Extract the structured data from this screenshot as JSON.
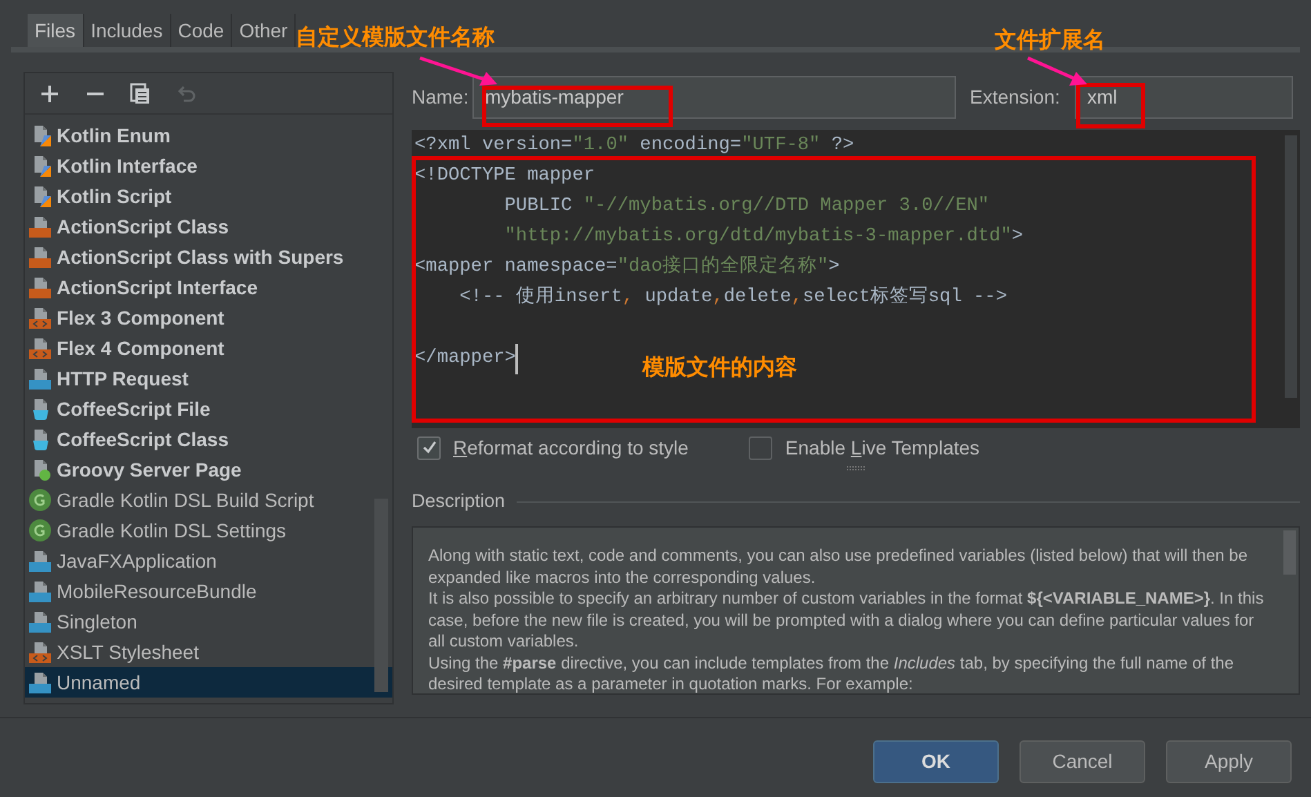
{
  "tabs": [
    {
      "label": "Files",
      "selected": true
    },
    {
      "label": "Includes",
      "selected": false
    },
    {
      "label": "Code",
      "selected": false
    },
    {
      "label": "Other",
      "selected": false
    }
  ],
  "toolbar": [
    {
      "kind": "add",
      "disabled": false
    },
    {
      "kind": "remove",
      "disabled": false
    },
    {
      "kind": "copy",
      "disabled": false
    },
    {
      "kind": "undo",
      "disabled": true
    }
  ],
  "templates": [
    {
      "label": "Kotlin Enum",
      "kind": "kotlin",
      "bold": true,
      "selected": false
    },
    {
      "label": "Kotlin Interface",
      "kind": "kotlin",
      "bold": true,
      "selected": false
    },
    {
      "label": "Kotlin Script",
      "kind": "kotlin",
      "bold": true,
      "selected": false
    },
    {
      "label": "ActionScript Class",
      "kind": "as",
      "bold": true,
      "selected": false
    },
    {
      "label": "ActionScript Class with Supers",
      "kind": "as",
      "bold": true,
      "selected": false
    },
    {
      "label": "ActionScript Interface",
      "kind": "as",
      "bold": true,
      "selected": false
    },
    {
      "label": "Flex 3 Component",
      "kind": "markup",
      "bold": true,
      "selected": false
    },
    {
      "label": "Flex 4 Component",
      "kind": "markup",
      "bold": true,
      "selected": false
    },
    {
      "label": "HTTP Request",
      "kind": "api",
      "bold": true,
      "selected": false
    },
    {
      "label": "CoffeeScript File",
      "kind": "coffee",
      "bold": true,
      "selected": false
    },
    {
      "label": "CoffeeScript Class",
      "kind": "coffee",
      "bold": true,
      "selected": false
    },
    {
      "label": "Groovy Server Page",
      "kind": "groovy",
      "bold": true,
      "selected": false
    },
    {
      "label": "Gradle Kotlin DSL Build Script",
      "kind": "gradle",
      "bold": false,
      "selected": false
    },
    {
      "label": "Gradle Kotlin DSL Settings",
      "kind": "gradle",
      "bold": false,
      "selected": false
    },
    {
      "label": "JavaFXApplication",
      "kind": "java",
      "bold": false,
      "selected": false
    },
    {
      "label": "MobileResourceBundle",
      "kind": "java",
      "bold": false,
      "selected": false
    },
    {
      "label": "Singleton",
      "kind": "java",
      "bold": false,
      "selected": false
    },
    {
      "label": "XSLT Stylesheet",
      "kind": "markup",
      "bold": false,
      "selected": false
    },
    {
      "label": "Unnamed",
      "kind": "java",
      "bold": false,
      "selected": true
    }
  ],
  "name_field": {
    "label": "Name:",
    "value": "mybatis-mapper"
  },
  "extension_field": {
    "label": "Extension:",
    "value": "xml"
  },
  "code_lines": [
    {
      "kind": "code",
      "segments": [
        {
          "text": "<?xml version=",
          "kind": "tag"
        },
        {
          "text": "\"1.0\"",
          "kind": "string"
        },
        {
          "text": " encoding=",
          "kind": "tag"
        },
        {
          "text": "\"UTF-8\"",
          "kind": "string"
        },
        {
          "text": " ?>",
          "kind": "tag"
        }
      ],
      "caret": false
    },
    {
      "kind": "code",
      "segments": [
        {
          "text": "<!DOCTYPE mapper",
          "kind": "tag"
        }
      ],
      "caret": false
    },
    {
      "kind": "code",
      "segments": [
        {
          "text": "        PUBLIC ",
          "kind": "tag"
        },
        {
          "text": "\"-//mybatis.org//DTD Mapper 3.0//EN\"",
          "kind": "string"
        }
      ],
      "caret": false
    },
    {
      "kind": "code",
      "segments": [
        {
          "text": "        \"http://mybatis.org/dtd/mybatis-3-mapper.dtd\"",
          "kind": "string"
        },
        {
          "text": ">",
          "kind": "tag"
        }
      ],
      "caret": false
    },
    {
      "kind": "code",
      "segments": [
        {
          "text": "<mapper namespace=",
          "kind": "tag"
        },
        {
          "text": "\"dao接口的全限定名称\"",
          "kind": "string"
        },
        {
          "text": ">",
          "kind": "tag"
        }
      ],
      "caret": false
    },
    {
      "kind": "code",
      "segments": [
        {
          "text": "    <!-- 使用insert",
          "kind": "tag"
        },
        {
          "text": ",",
          "kind": "punct"
        },
        {
          "text": " update",
          "kind": "tag"
        },
        {
          "text": ",",
          "kind": "punct"
        },
        {
          "text": "delete",
          "kind": "tag"
        },
        {
          "text": ",",
          "kind": "punct"
        },
        {
          "text": "select标签写sql -->",
          "kind": "tag"
        }
      ],
      "caret": false
    },
    {
      "kind": "blank"
    },
    {
      "kind": "code",
      "segments": [
        {
          "text": "</mapper>",
          "kind": "tag"
        }
      ],
      "caret": true
    }
  ],
  "options": [
    {
      "mnemonic": "R",
      "after": "eformat according to style",
      "checked": true
    },
    {
      "before": "Enable ",
      "mnemonic": "L",
      "after": "ive Templates",
      "checked": false
    }
  ],
  "description": {
    "title": "Description",
    "paragraphs": [
      "Along with static text, code and comments, you can also use predefined variables (listed below) that will then be expanded like macros into the corresponding values.",
      "It is also possible to specify an arbitrary number of custom variables in the format **${<VARIABLE_NAME>}**. In this case, before the new file is created, you will be prompted with a dialog where you can define particular values for all custom variables.",
      "Using the **#parse** directive, you can include templates from the *Includes* tab, by specifying the full name of the desired template as a parameter in quotation marks. For example:"
    ]
  },
  "buttons": [
    {
      "label": "OK",
      "kind": "primary"
    },
    {
      "label": "Cancel",
      "kind": "normal"
    },
    {
      "label": "Apply",
      "kind": "normal"
    }
  ],
  "annotations": [
    {
      "text": "自定义模版文件名称"
    },
    {
      "text": "文件扩展名"
    },
    {
      "text": "模版文件的内容"
    }
  ]
}
